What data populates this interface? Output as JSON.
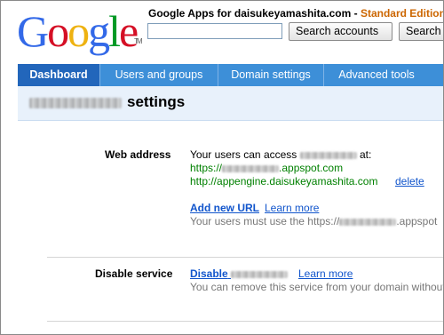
{
  "header": {
    "logo": "Google",
    "app_title": "Google Apps for daisukeyamashita.com",
    "separator": " - ",
    "edition": "Standard Edition",
    "search_accounts_label": "Search accounts",
    "search_help_label": "Search"
  },
  "nav": {
    "tabs": [
      {
        "label": "Dashboard"
      },
      {
        "label": "Users and groups"
      },
      {
        "label": "Domain settings"
      },
      {
        "label": "Advanced tools"
      }
    ]
  },
  "page": {
    "title_suffix": "settings"
  },
  "web_address": {
    "label": "Web address",
    "intro_prefix": "Your users can access",
    "intro_suffix": "at:",
    "url1_prefix": "https://",
    "url1_suffix": ".appspot.com",
    "url2": "http://appengine.daisukeyamashita.com",
    "delete_label": "delete",
    "add_new_url_label": "Add new URL",
    "learn_more_label": "Learn more",
    "note_prefix": "Your users must use the https://",
    "note_suffix": ".appspot"
  },
  "disable_service": {
    "label": "Disable service",
    "disable_prefix": "Disable",
    "learn_more_label": "Learn more",
    "note": "You can remove this service from your domain without"
  },
  "colors": {
    "nav": "#3d8fd8",
    "nav_active": "#2266bb",
    "url_green": "#008000",
    "link": "#1155cc",
    "edition": "#cc6600"
  }
}
